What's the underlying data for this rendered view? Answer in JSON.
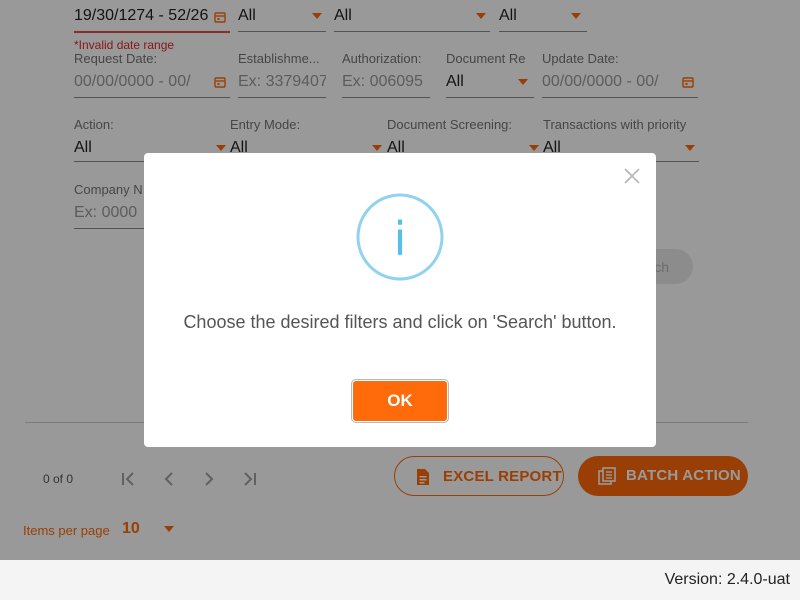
{
  "filters": {
    "row0": {
      "date_value": "19/30/1274 - 52/26",
      "select1": "All",
      "select2": "All",
      "select3": "All",
      "error": "*Invalid date range"
    },
    "row1": [
      {
        "label": "Request Date:",
        "placeholder": "00/00/0000 - 00/"
      },
      {
        "label": "Establishme...",
        "placeholder": "Ex: 3379407"
      },
      {
        "label": "Authorization:",
        "placeholder": "Ex: 006095"
      },
      {
        "label": "Document Re",
        "value": "All"
      },
      {
        "label": "Update Date:",
        "placeholder": "00/00/0000 - 00/"
      }
    ],
    "row2": [
      {
        "label": "Action:",
        "value": "All"
      },
      {
        "label": "Entry Mode:",
        "value": "All"
      },
      {
        "label": "Document Screening:",
        "value": "All"
      },
      {
        "label": "Transactions with priority",
        "value": "All"
      }
    ],
    "row3": {
      "label": "Company N",
      "placeholder": "Ex: 0000"
    },
    "search_label": "ch"
  },
  "paginator": {
    "range": "0 of 0",
    "items_per_page_label": "Items per page",
    "items_per_page_value": "10"
  },
  "actions": {
    "excel_report": "EXCEL REPORT",
    "batch_action": "BATCH ACTION"
  },
  "modal": {
    "icon_glyph": "i",
    "message": "Choose the desired filters and click on 'Search' button.",
    "ok_label": "OK"
  },
  "footer": {
    "version": "Version: 2.4.0-uat"
  },
  "colors": {
    "accent": "#ff6a0a",
    "info_ring": "#8fd3ee",
    "error": "#e02b2b"
  }
}
